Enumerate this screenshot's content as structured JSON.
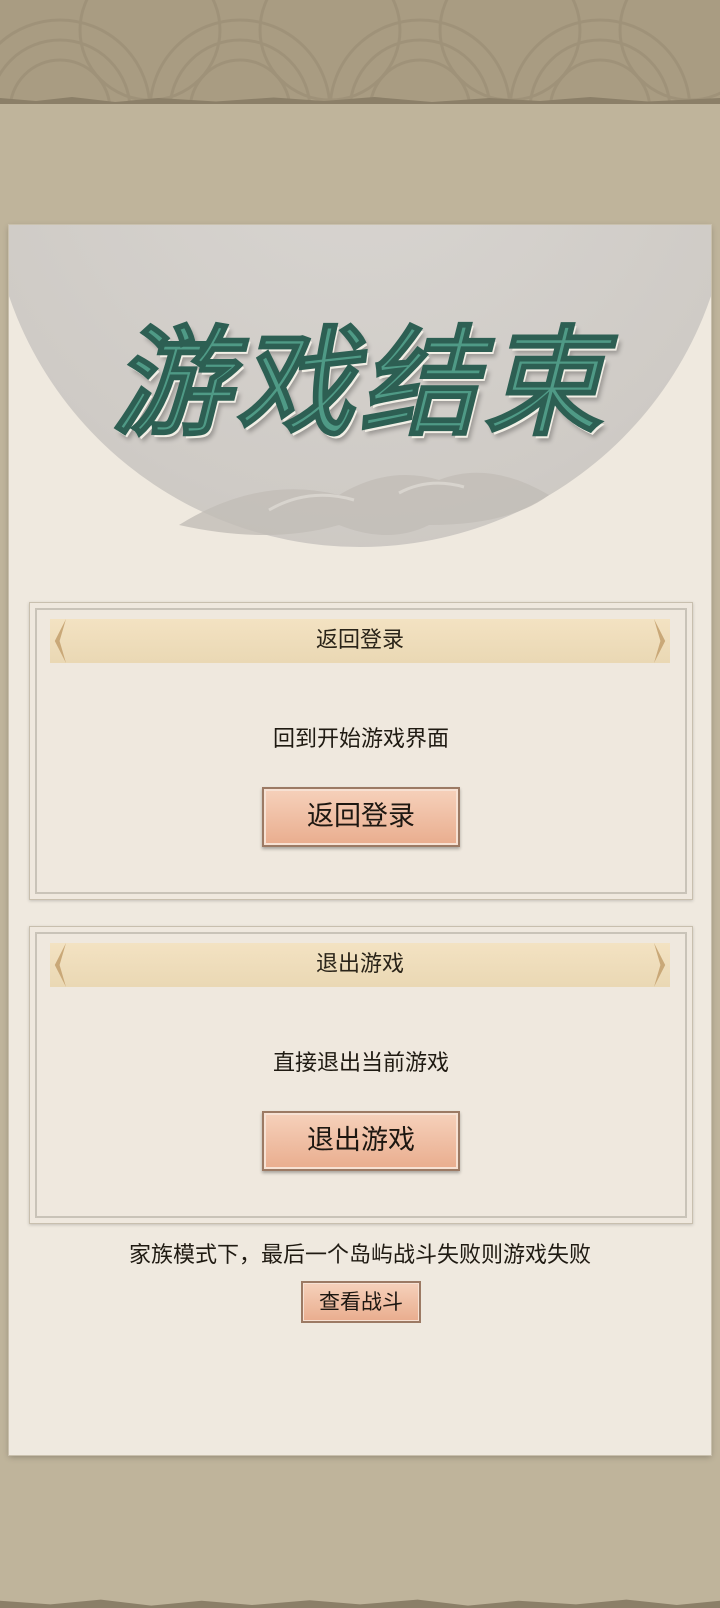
{
  "title": "游戏结束",
  "cards": [
    {
      "header": "返回登录",
      "description": "回到开始游戏界面",
      "button_label": "返回登录"
    },
    {
      "header": "退出游戏",
      "description": "直接退出当前游戏",
      "button_label": "退出游戏"
    }
  ],
  "footer": {
    "message": "家族模式下，最后一个岛屿战斗失败则游戏失败",
    "button_label": "查看战斗"
  }
}
